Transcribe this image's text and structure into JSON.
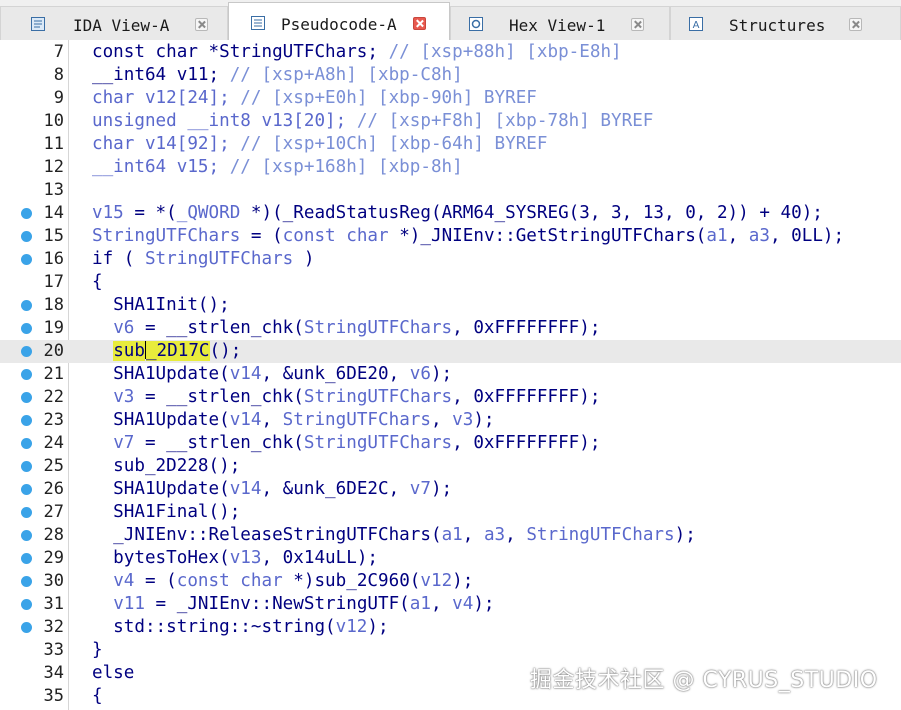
{
  "tabs": [
    {
      "label": "IDA View-A",
      "icon": "ida-view-icon",
      "active": false
    },
    {
      "label": "Pseudocode-A",
      "icon": "pseudocode-icon",
      "active": true
    },
    {
      "label": "Hex View-1",
      "icon": "hex-view-icon",
      "active": false
    },
    {
      "label": "Structures",
      "icon": "structures-icon",
      "active": false
    }
  ],
  "colors": {
    "keyword_identifier": "#000080",
    "comment": "#7a8fd6",
    "variable": "#5a68cc",
    "highlight": "#e8ec3c",
    "breakpoint": "#3aa3e8",
    "current_line_bg": "#e9e9e9"
  },
  "code": {
    "current_line": 20,
    "lines": [
      {
        "n": "7",
        "bp": false,
        "tokens": [
          [
            "id",
            "const char *StringUTFChars; "
          ],
          [
            "cmt",
            "// [xsp+88h] [xbp-E8h]"
          ]
        ]
      },
      {
        "n": "8",
        "bp": false,
        "tokens": [
          [
            "id",
            "__int64 v11; "
          ],
          [
            "cmt",
            "// [xsp+A8h] [xbp-C8h]"
          ]
        ]
      },
      {
        "n": "9",
        "bp": false,
        "tokens": [
          [
            "var",
            "char v12[24]; "
          ],
          [
            "cmt",
            "// [xsp+E0h] [xbp-90h] BYREF"
          ]
        ]
      },
      {
        "n": "10",
        "bp": false,
        "tokens": [
          [
            "var",
            "unsigned __int8 v13[20]; "
          ],
          [
            "cmt",
            "// [xsp+F8h] [xbp-78h] BYREF"
          ]
        ]
      },
      {
        "n": "11",
        "bp": false,
        "tokens": [
          [
            "var",
            "char v14[92]; "
          ],
          [
            "cmt",
            "// [xsp+10Ch] [xbp-64h] BYREF"
          ]
        ]
      },
      {
        "n": "12",
        "bp": false,
        "tokens": [
          [
            "var",
            "__int64 v15; "
          ],
          [
            "cmt",
            "// [xsp+168h] [xbp-8h]"
          ]
        ]
      },
      {
        "n": "13",
        "bp": false,
        "tokens": []
      },
      {
        "n": "14",
        "bp": true,
        "tokens": [
          [
            "var",
            "v15"
          ],
          [
            "id",
            " = *("
          ],
          [
            "var",
            "_QWORD"
          ],
          [
            "id",
            " *)(_ReadStatusReg(ARM64_SYSREG(3, 3, 13, 0, 2)) + 40);"
          ]
        ]
      },
      {
        "n": "15",
        "bp": true,
        "tokens": [
          [
            "var",
            "StringUTFChars"
          ],
          [
            "id",
            " = ("
          ],
          [
            "var",
            "const char"
          ],
          [
            "id",
            " *)_JNIEnv::GetStringUTFChars("
          ],
          [
            "var",
            "a1"
          ],
          [
            "id",
            ", "
          ],
          [
            "var",
            "a3"
          ],
          [
            "id",
            ", 0LL);"
          ]
        ]
      },
      {
        "n": "16",
        "bp": true,
        "tokens": [
          [
            "id",
            "if ( "
          ],
          [
            "var",
            "StringUTFChars"
          ],
          [
            "id",
            " )"
          ]
        ]
      },
      {
        "n": "17",
        "bp": false,
        "tokens": [
          [
            "id",
            "{"
          ]
        ]
      },
      {
        "n": "18",
        "bp": true,
        "tokens": [
          [
            "id",
            "  SHA1Init();"
          ]
        ]
      },
      {
        "n": "19",
        "bp": true,
        "tokens": [
          [
            "id",
            "  "
          ],
          [
            "var",
            "v6"
          ],
          [
            "id",
            " = __strlen_chk("
          ],
          [
            "var",
            "StringUTFChars"
          ],
          [
            "id",
            ", 0xFFFFFFFF);"
          ]
        ]
      },
      {
        "n": "20",
        "bp": true,
        "tokens": [
          [
            "id",
            "  "
          ],
          [
            "hl",
            "sub"
          ],
          [
            "caret",
            ""
          ],
          [
            "hl",
            "_2D17C"
          ],
          [
            "id",
            "();"
          ]
        ]
      },
      {
        "n": "21",
        "bp": true,
        "tokens": [
          [
            "id",
            "  SHA1Update("
          ],
          [
            "var",
            "v14"
          ],
          [
            "id",
            ", &unk_6DE20, "
          ],
          [
            "var",
            "v6"
          ],
          [
            "id",
            ");"
          ]
        ]
      },
      {
        "n": "22",
        "bp": true,
        "tokens": [
          [
            "id",
            "  "
          ],
          [
            "var",
            "v3"
          ],
          [
            "id",
            " = __strlen_chk("
          ],
          [
            "var",
            "StringUTFChars"
          ],
          [
            "id",
            ", 0xFFFFFFFF);"
          ]
        ]
      },
      {
        "n": "23",
        "bp": true,
        "tokens": [
          [
            "id",
            "  SHA1Update("
          ],
          [
            "var",
            "v14"
          ],
          [
            "id",
            ", "
          ],
          [
            "var",
            "StringUTFChars"
          ],
          [
            "id",
            ", "
          ],
          [
            "var",
            "v3"
          ],
          [
            "id",
            ");"
          ]
        ]
      },
      {
        "n": "24",
        "bp": true,
        "tokens": [
          [
            "id",
            "  "
          ],
          [
            "var",
            "v7"
          ],
          [
            "id",
            " = __strlen_chk("
          ],
          [
            "var",
            "StringUTFChars"
          ],
          [
            "id",
            ", 0xFFFFFFFF);"
          ]
        ]
      },
      {
        "n": "25",
        "bp": true,
        "tokens": [
          [
            "id",
            "  sub_2D228();"
          ]
        ]
      },
      {
        "n": "26",
        "bp": true,
        "tokens": [
          [
            "id",
            "  SHA1Update("
          ],
          [
            "var",
            "v14"
          ],
          [
            "id",
            ", &unk_6DE2C, "
          ],
          [
            "var",
            "v7"
          ],
          [
            "id",
            ");"
          ]
        ]
      },
      {
        "n": "27",
        "bp": true,
        "tokens": [
          [
            "id",
            "  SHA1Final();"
          ]
        ]
      },
      {
        "n": "28",
        "bp": true,
        "tokens": [
          [
            "id",
            "  _JNIEnv::ReleaseStringUTFChars("
          ],
          [
            "var",
            "a1"
          ],
          [
            "id",
            ", "
          ],
          [
            "var",
            "a3"
          ],
          [
            "id",
            ", "
          ],
          [
            "var",
            "StringUTFChars"
          ],
          [
            "id",
            ");"
          ]
        ]
      },
      {
        "n": "29",
        "bp": true,
        "tokens": [
          [
            "id",
            "  bytesToHex("
          ],
          [
            "var",
            "v13"
          ],
          [
            "id",
            ", 0x14uLL);"
          ]
        ]
      },
      {
        "n": "30",
        "bp": true,
        "tokens": [
          [
            "id",
            "  "
          ],
          [
            "var",
            "v4"
          ],
          [
            "id",
            " = ("
          ],
          [
            "var",
            "const char"
          ],
          [
            "id",
            " *)sub_2C960("
          ],
          [
            "var",
            "v12"
          ],
          [
            "id",
            ");"
          ]
        ]
      },
      {
        "n": "31",
        "bp": true,
        "tokens": [
          [
            "id",
            "  "
          ],
          [
            "var",
            "v11"
          ],
          [
            "id",
            " = _JNIEnv::NewStringUTF("
          ],
          [
            "var",
            "a1"
          ],
          [
            "id",
            ", "
          ],
          [
            "var",
            "v4"
          ],
          [
            "id",
            ");"
          ]
        ]
      },
      {
        "n": "32",
        "bp": true,
        "tokens": [
          [
            "id",
            "  std::string::~string("
          ],
          [
            "var",
            "v12"
          ],
          [
            "id",
            ");"
          ]
        ]
      },
      {
        "n": "33",
        "bp": false,
        "tokens": [
          [
            "id",
            "}"
          ]
        ]
      },
      {
        "n": "34",
        "bp": false,
        "tokens": [
          [
            "id",
            "else"
          ]
        ]
      },
      {
        "n": "35",
        "bp": false,
        "tokens": [
          [
            "id",
            "{"
          ]
        ]
      }
    ]
  },
  "watermark": "掘金技术社区 @ CYRUS_STUDIO"
}
